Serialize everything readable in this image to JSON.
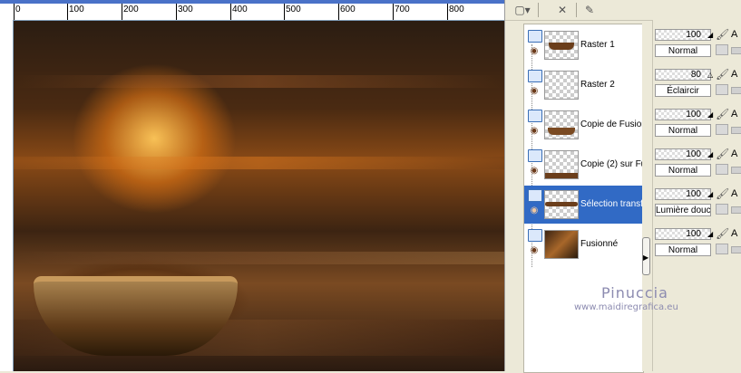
{
  "ruler": {
    "labels": [
      "0",
      "100",
      "200",
      "300",
      "400",
      "500",
      "600",
      "700",
      "800"
    ]
  },
  "layers": [
    {
      "name": "Raster 1",
      "opacity": "100",
      "blend": "Normal",
      "selected": false
    },
    {
      "name": "Raster 2",
      "opacity": "80",
      "blend": "Éclaircir",
      "selected": false
    },
    {
      "name": "Copie de Fusion",
      "opacity": "100",
      "blend": "Normal",
      "selected": false
    },
    {
      "name": "Copie (2) sur Fu",
      "opacity": "100",
      "blend": "Normal",
      "selected": false
    },
    {
      "name": "Sélection transfo",
      "opacity": "100",
      "blend": "Lumière douce",
      "selected": true
    },
    {
      "name": "Fusionné",
      "opacity": "100",
      "blend": "Normal",
      "selected": false
    }
  ],
  "props": {
    "a_label": "A"
  },
  "watermark": {
    "name": "Pinuccia",
    "url": "www.maidiregrafica.eu"
  },
  "colors": {
    "selection": "#316ac5",
    "panel_bg": "#ece9d8",
    "watermark": "#8c8bb0"
  }
}
